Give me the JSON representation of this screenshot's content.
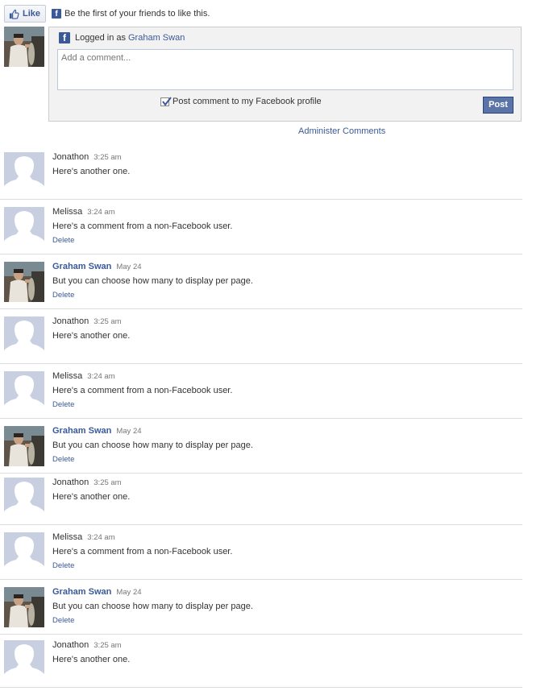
{
  "like_bar": {
    "button_label": "Like",
    "text": "Be the first of your friends to like this."
  },
  "composer": {
    "logged_in_prefix": "Logged in as",
    "user_name": "Graham Swan",
    "placeholder": "Add a comment...",
    "post_to_profile_label": "Post comment to my Facebook profile",
    "post_to_profile_checked": true,
    "post_button": "Post"
  },
  "admin_link": "Administer Comments",
  "colors": {
    "facebook_blue": "#3b5998",
    "post_button": "#5b74a8",
    "silhouette": "#c8cfe0"
  },
  "comments": [
    {
      "author": "Jonathon",
      "facebook_user": false,
      "time": "3:25 am",
      "text": "Here's another one.",
      "deletable": false
    },
    {
      "author": "Melissa",
      "facebook_user": false,
      "time": "3:24 am",
      "text": "Here's a comment from a non-Facebook user.",
      "deletable": true,
      "delete_label": "Delete"
    },
    {
      "author": "Graham Swan",
      "facebook_user": true,
      "time": "May 24",
      "text": "But you can choose how many to display per page.",
      "deletable": true,
      "delete_label": "Delete"
    },
    {
      "author": "Jonathon",
      "facebook_user": false,
      "time": "3:25 am",
      "text": "Here's another one.",
      "deletable": false
    },
    {
      "author": "Melissa",
      "facebook_user": false,
      "time": "3:24 am",
      "text": "Here's a comment from a non-Facebook user.",
      "deletable": true,
      "delete_label": "Delete"
    },
    {
      "author": "Graham Swan",
      "facebook_user": true,
      "time": "May 24",
      "text": "But you can choose how many to display per page.",
      "deletable": true,
      "delete_label": "Delete"
    },
    {
      "author": "Jonathon",
      "facebook_user": false,
      "time": "3:25 am",
      "text": "Here's another one.",
      "deletable": false
    },
    {
      "author": "Melissa",
      "facebook_user": false,
      "time": "3:24 am",
      "text": "Here's a comment from a non-Facebook user.",
      "deletable": true,
      "delete_label": "Delete"
    },
    {
      "author": "Graham Swan",
      "facebook_user": true,
      "time": "May 24",
      "text": "But you can choose how many to display per page.",
      "deletable": true,
      "delete_label": "Delete"
    },
    {
      "author": "Jonathon",
      "facebook_user": false,
      "time": "3:25 am",
      "text": "Here's another one.",
      "deletable": false
    }
  ]
}
